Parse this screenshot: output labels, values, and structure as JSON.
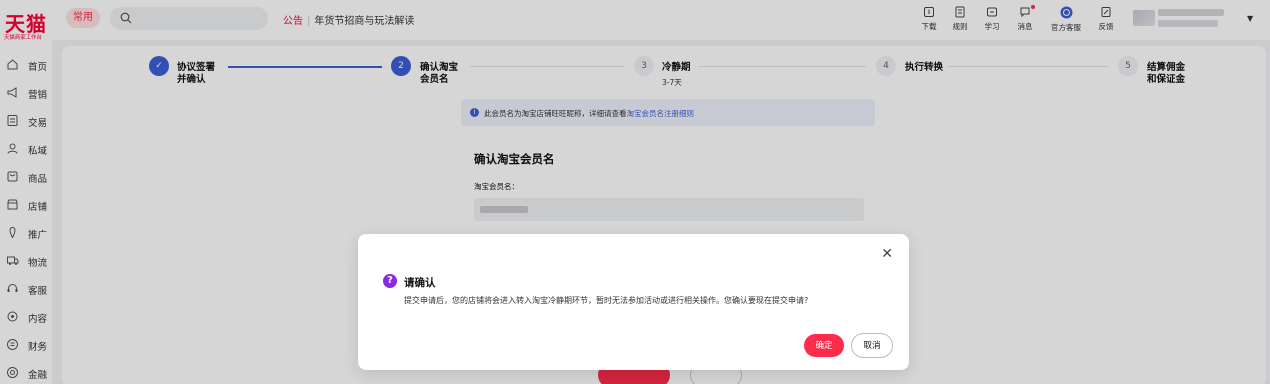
{
  "header": {
    "logo": "天猫",
    "logo_sub": "天猫商家工作台",
    "common_label": "常用",
    "search_placeholder": "",
    "notice_tag": "公告",
    "notice_text": "年货节招商与玩法解读",
    "tools": [
      {
        "label": "下载",
        "icon": "download-icon"
      },
      {
        "label": "规则",
        "icon": "rules-icon"
      },
      {
        "label": "学习",
        "icon": "learn-icon"
      },
      {
        "label": "消息",
        "icon": "message-icon"
      },
      {
        "label": "官方客服",
        "icon": "service-icon"
      },
      {
        "label": "反馈",
        "icon": "feedback-icon"
      }
    ]
  },
  "sidebar": {
    "items": [
      {
        "label": "首页",
        "icon": "home-icon"
      },
      {
        "label": "营销",
        "icon": "megaphone-icon"
      },
      {
        "label": "交易",
        "icon": "order-icon"
      },
      {
        "label": "私域",
        "icon": "users-icon"
      },
      {
        "label": "商品",
        "icon": "goods-icon"
      },
      {
        "label": "店铺",
        "icon": "store-icon"
      },
      {
        "label": "推广",
        "icon": "promote-icon"
      },
      {
        "label": "物流",
        "icon": "truck-icon"
      },
      {
        "label": "客服",
        "icon": "headset-icon"
      },
      {
        "label": "内容",
        "icon": "content-icon"
      },
      {
        "label": "财务",
        "icon": "finance-icon"
      },
      {
        "label": "金融",
        "icon": "coin-icon"
      }
    ]
  },
  "steps": [
    {
      "num": "✓",
      "line1": "协议签署",
      "line2": "并确认",
      "state": "done"
    },
    {
      "num": "2",
      "line1": "确认淘宝",
      "line2": "会员名",
      "state": "active"
    },
    {
      "num": "3",
      "line1": "冷静期",
      "line2": "3-7天",
      "state": "todo"
    },
    {
      "num": "4",
      "line1": "执行转换",
      "line2": "",
      "state": "todo"
    },
    {
      "num": "5",
      "line1": "结算佣金",
      "line2": "和保证金",
      "state": "todo"
    }
  ],
  "info": {
    "text": "此会员名为淘宝店铺旺旺昵称，详细请查看",
    "link": "淘宝会员名注册细则"
  },
  "form": {
    "section_title": "确认淘宝会员名",
    "field_label": "淘宝会员名："
  },
  "modal": {
    "title": "请确认",
    "message": "提交申请后，您的店铺将会进入转入淘宝冷静期环节，暂时无法参加活动或进行相关操作。您确认要现在提交申请?",
    "ok_label": "确定",
    "cancel_label": "取消",
    "close_symbol": "✕"
  },
  "colors": {
    "brand": "#ff0036",
    "accent": "#3f5fd6",
    "primary_button": "#ff2b4b",
    "question_icon": "#8a2ae3"
  }
}
